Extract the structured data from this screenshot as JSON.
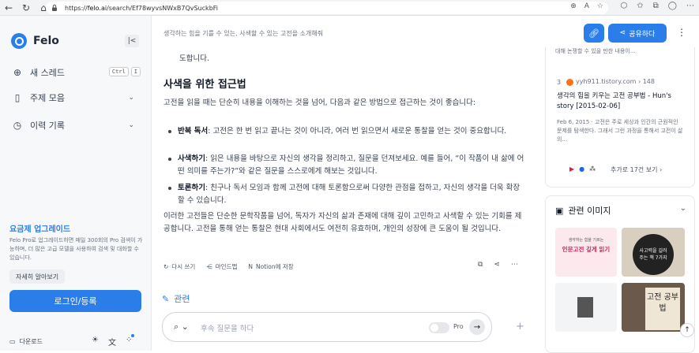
{
  "browser": {
    "url_prefix": "https://",
    "url_host": "felo.ai",
    "url_path": "/search/Ef78wyvsNWxB7QvSuckbFi"
  },
  "sidebar": {
    "brand": "Felo",
    "new_thread_label": "새 스레드",
    "new_thread_shortcut": [
      "Ctrl",
      "I"
    ],
    "topic_label": "주제 모음",
    "history_label": "이력 기록",
    "upgrade_title": "요금제 업그레이드",
    "upgrade_desc": "Felo Pro로 업그레이드하면 매일 300회의 Pro 검색이 가능하며, 더 많은 고급 모델을 사용하여 검색 및 대화할 수 있습니다.",
    "learn_more": "자세히 알아보기",
    "login": "로그인/등록",
    "download": "다운로드"
  },
  "topbar": {
    "title": "생각하는 힘을 기를 수 있는, 사색할 수 있는 고전을 소개해줘",
    "share_label": "공유하다"
  },
  "main": {
    "intro_tail": "도합니다.",
    "heading": "사색을 위한 접근법",
    "intro_para": "고전을 읽을 때는 단순히 내용을 이해하는 것을 넘어, 다음과 같은 방법으로 접근하는 것이 좋습니다:",
    "bullets": [
      {
        "bold": "반복 독서",
        "text": ": 고전은 한 번 읽고 끝나는 것이 아니라, 여러 번 읽으면서 새로운 통찰을 얻는 것이 중요합니다."
      },
      {
        "bold": "사색하기",
        "text": ": 읽은 내용을 바탕으로 자신의 생각을 정리하고, 질문을 던져보세요. 예를 들어, “이 작품이 내 삶에 어떤 의미를 주는가?”와 같은 질문을 스스로에게 해보는 것입니다."
      },
      {
        "bold": "토론하기",
        "text": ": 친구나 독서 모임과 함께 고전에 대해 토론함으로써 다양한 관점을 접하고, 자신의 생각을 더욱 확장할 수 있습니다."
      }
    ],
    "conclusion": "이러한 고전들은 단순한 문학작품을 넘어, 독자가 자신의 삶과 존재에 대해 깊이 고민하고 사색할 수 있는 기회를 제공합니다. 고전을 통해 얻는 통찰은 현대 사회에서도 여전히 유효하며, 개인의 성장에 큰 도움이 될 것입니다.",
    "actions": [
      "다시 쓰기",
      "마인드맵",
      "Notion에 저장"
    ],
    "related_label": "관련",
    "ask_placeholder": "후속 질문을 하다",
    "pro_label": "Pro"
  },
  "sources": {
    "prev_snippet": "대해 논쟁할 수 있을 만한 내용이...",
    "item": {
      "index": "3",
      "site": "yyh911.tistory.com",
      "count": "› 148",
      "title": "생각의 힘을 키우는 고전 공부법 - Hun's story [2015-02-06]",
      "snippet": "Feb 6, 2015 · 고전은 주로 세상과 인간의 근원적인 문제를 탐색한다. 그래서 그런 과정을 통해서 고전이 삶의..."
    },
    "more_label": "추가로 17건 보기",
    "more_arrow": "›"
  },
  "images": {
    "title": "관련 이미지",
    "thumb1_text": "인문고전 깊게 읽기",
    "thumb1_small": "생각하는 힘을 기르는",
    "thumb2_text": "사고력을 길러주는 책 7가지",
    "thumb4_text": "고전 공부법"
  }
}
